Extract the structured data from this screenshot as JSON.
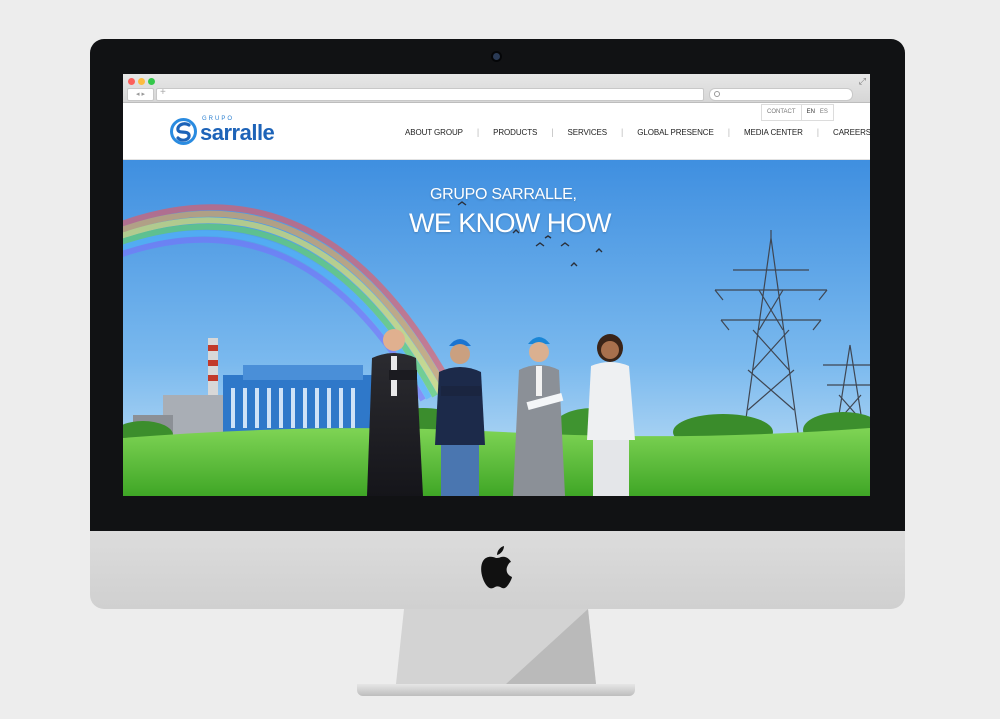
{
  "browser": {
    "nav_arrows": "◂ ▸",
    "new_tab": "+",
    "expand_icon": "⤢"
  },
  "site": {
    "logo_prefix": "GRUPO",
    "logo_name": "sarralle",
    "brand_color": "#1d63b8",
    "top_links": {
      "contact": "CONTACT",
      "lang_en": "EN",
      "lang_es": "ES"
    },
    "nav": [
      {
        "label": "ABOUT GROUP"
      },
      {
        "label": "PRODUCTS"
      },
      {
        "label": "SERVICES"
      },
      {
        "label": "GLOBAL PRESENCE"
      },
      {
        "label": "MEDIA CENTER"
      },
      {
        "label": "CAREERS"
      }
    ]
  },
  "hero": {
    "line1": "GRUPO SARRALLE,",
    "line2": "WE KNOW HOW",
    "sky_color": "#4f9fe8",
    "grass_color": "#5cc43a"
  }
}
